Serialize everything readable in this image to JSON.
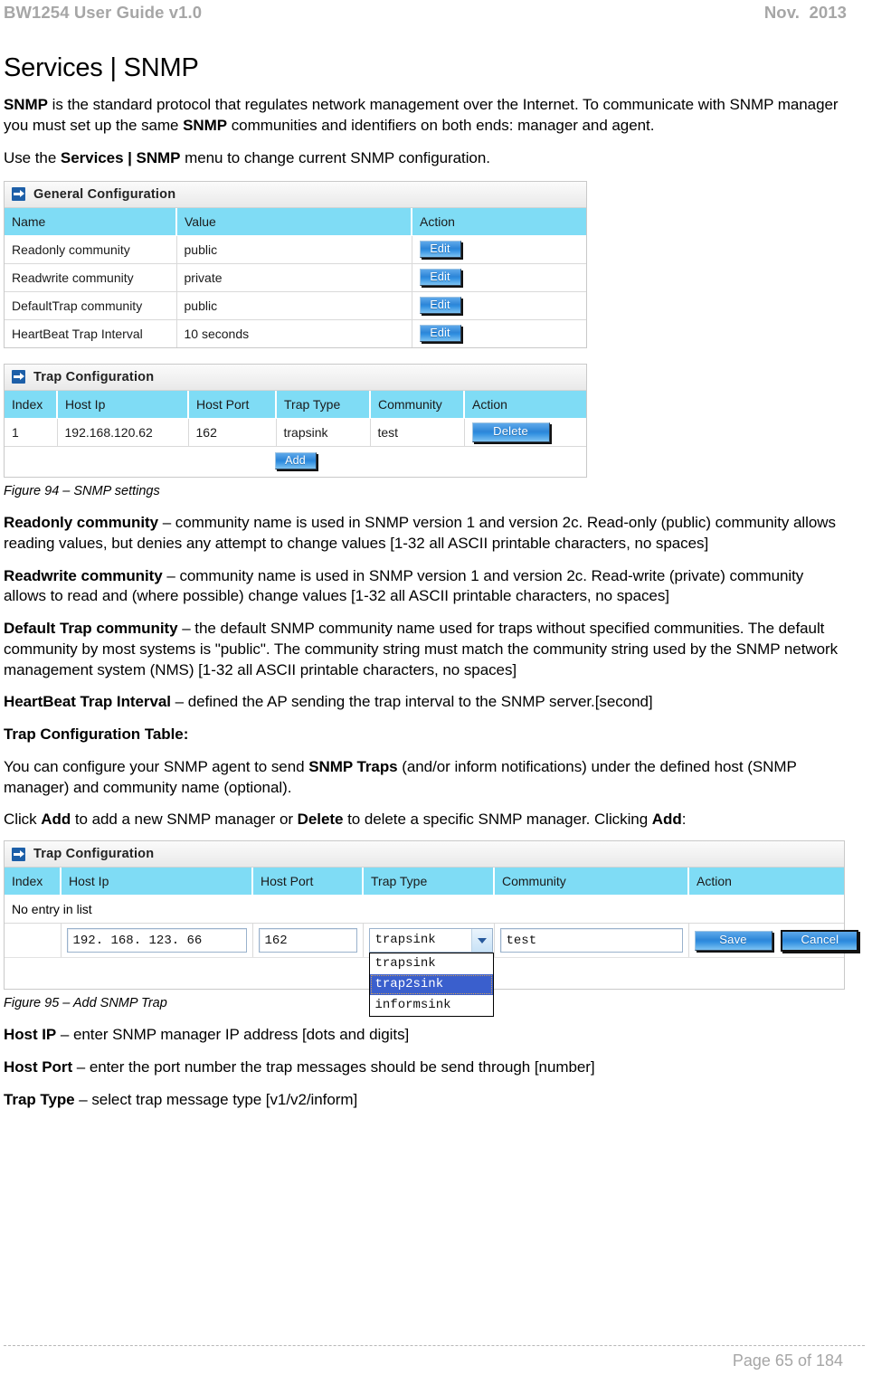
{
  "header": {
    "left": "BW1254 User Guide v1.0",
    "right": "Nov.  2013"
  },
  "section": {
    "title": "Services | SNMP"
  },
  "intro": {
    "p1_a": "SNMP",
    "p1_b": " is the standard protocol that regulates network management over the Internet. To communicate with SNMP manager you must set up the same ",
    "p1_c": "SNMP",
    "p1_d": " communities and identifiers on both ends: manager and agent.",
    "p2_a": "Use the ",
    "p2_b": "Services | SNMP",
    "p2_c": " menu to change current SNMP configuration."
  },
  "figure94": {
    "caption": "Figure 94 – SNMP settings",
    "general_panel": {
      "title": "General Configuration",
      "columns": [
        "Name",
        "Value",
        "Action"
      ],
      "rows": [
        {
          "name": "Readonly community",
          "value": "public",
          "action": "Edit"
        },
        {
          "name": "Readwrite community",
          "value": "private",
          "action": "Edit"
        },
        {
          "name": "DefaultTrap community",
          "value": "public",
          "action": "Edit"
        },
        {
          "name": "HeartBeat Trap Interval",
          "value": "10 seconds",
          "action": "Edit"
        }
      ]
    },
    "trap_panel": {
      "title": "Trap Configuration",
      "columns": [
        "Index",
        "Host Ip",
        "Host Port",
        "Trap Type",
        "Community",
        "Action"
      ],
      "rows": [
        {
          "index": "1",
          "host_ip": "192.168.120.62",
          "host_port": "162",
          "trap_type": "trapsink",
          "community": "test",
          "action": "Delete"
        }
      ],
      "add_label": "Add"
    }
  },
  "descriptions": {
    "readonly_term": "Readonly community",
    "readonly_text": " – community name is used in SNMP version 1 and version 2c. Read-only (public) community allows reading values, but denies any attempt to change values [1-32 all ASCII printable characters, no spaces]",
    "readwrite_term": "Readwrite community",
    "readwrite_text": " – community name is used in SNMP version 1 and version 2c. Read-write (private) community allows to read and (where possible) change values [1-32 all ASCII printable characters, no spaces]",
    "defaulttrap_term": "Default Trap community",
    "defaulttrap_text": " – the default SNMP community name used for traps without specified communities. The default community by most systems is \"public\". The community string must match the community string used by the SNMP network management system (NMS) [1-32 all ASCII printable characters, no spaces]",
    "heartbeat_term": "HeartBeat Trap Interval ",
    "heartbeat_text": " – defined the AP sending the trap interval to the SNMP server.[second]",
    "trap_table_heading": "Trap Configuration Table:",
    "trap_intro_a": "You can configure your SNMP agent to send ",
    "trap_intro_b": "SNMP Traps",
    "trap_intro_c": " (and/or inform notifications) under the defined host (SNMP manager) and community name (optional).",
    "click_a": "Click ",
    "click_b": "Add",
    "click_c": " to add a new SNMP manager or ",
    "click_d": "Delete",
    "click_e": " to delete a specific SNMP manager. Clicking ",
    "click_f": "Add",
    "click_g": ":"
  },
  "figure95": {
    "caption": "Figure 95 – Add SNMP Trap",
    "panel": {
      "title": "Trap Configuration",
      "columns": [
        "Index",
        "Host Ip",
        "Host Port",
        "Trap Type",
        "Community",
        "Action"
      ],
      "empty_message": "No entry in list",
      "form": {
        "host_ip_value": "192. 168. 123. 66",
        "host_port_value": "162",
        "trap_type_value": "trapsink",
        "trap_type_options": [
          "trapsink",
          "trap2sink",
          "informsink"
        ],
        "trap_type_highlighted": "trap2sink",
        "community_value": "test",
        "save_label": "Save",
        "cancel_label": "Cancel"
      }
    }
  },
  "field_descriptions": {
    "host_ip_term": "Host IP",
    "host_ip_text": " – enter SNMP manager IP address [dots and digits]",
    "host_port_term": "Host Port",
    "host_port_text": " – enter the port number the trap messages should be send through [number]",
    "trap_type_term": "Trap Type",
    "trap_type_text": " – select trap message type [v1/v2/inform]"
  },
  "footer": {
    "page_label": "Page 65 of 184"
  },
  "colors": {
    "table_header": "#7fdcf5",
    "button_blue": "#2d86d8",
    "select_highlight": "#3a5fcd",
    "header_gray": "#a6a6a6"
  }
}
